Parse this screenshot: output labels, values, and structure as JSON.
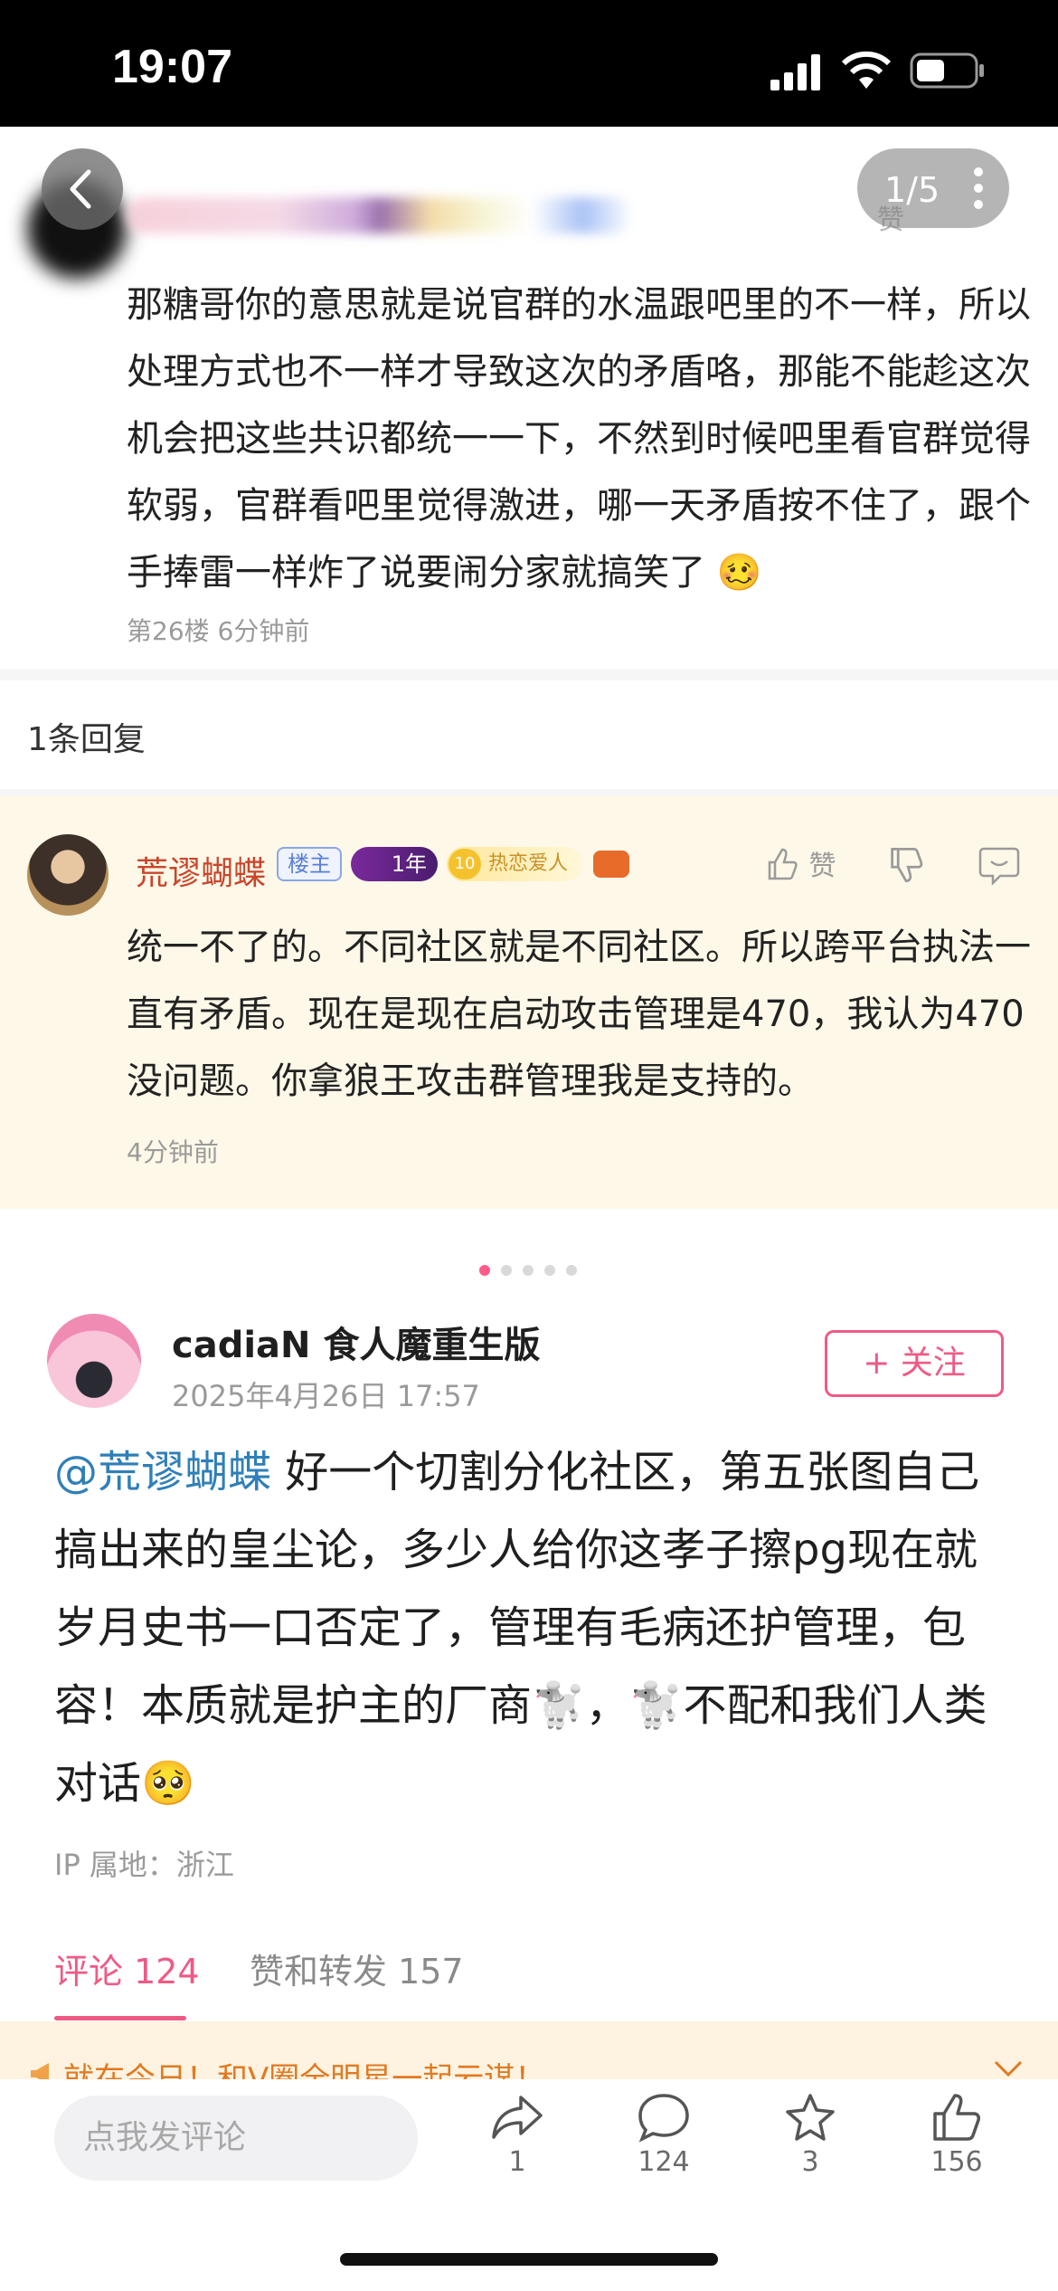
{
  "status_bar": {
    "time": "19:07"
  },
  "screenshot": {
    "pager": "1/5",
    "ghost_like": "赞",
    "comment_text": "那糖哥你的意思就是说官群的水温跟吧里的不一样，所以处理方式也不一样才导致这次的矛盾咯，那能不能趁这次机会把这些共识都统一一下，不然到时候吧里看官群觉得软弱，官群看吧里觉得激进，哪一天矛盾按不住了，跟个手捧雷一样炸了说要闹分家就搞笑了 🥴",
    "comment_meta": "第26楼  6分钟前",
    "reply_header": "1条回复",
    "reply": {
      "name": "荒谬蝴蝶",
      "badge_owner": "楼主",
      "badge_years": "1年",
      "badge_level_num": "10",
      "badge_level_text": "热恋爱人",
      "like_label": "赞",
      "text": "统一不了的。不同社区就是不同社区。所以跨平台执法一直有矛盾。现在是现在启动攻击管理是470，我认为470没问题。你拿狼王攻击群管理我是支持的。",
      "meta": "4分钟前"
    }
  },
  "post": {
    "author": "cadiaN 食人魔重生版",
    "date": "2025年4月26日 17:57",
    "follow_label": "+ 关注",
    "mention": "@荒谬蝴蝶",
    "body": " 好一个切割分化社区，第五张图自己搞出来的皇尘论，多少人给你这孝子擦pg现在就岁月史书一口否定了，管理有毛病还护管理，包容！本质就是护主的厂商🐩，🐩不配和我们人类对话🥺",
    "ip_location": "IP 属地：浙江",
    "image_index": 1,
    "image_total": 5
  },
  "tabs": {
    "comments": "评论 124",
    "likes_reposts": "赞和转发 157"
  },
  "promo": {
    "text": "就在今日！和V圈全明星一起云谋！"
  },
  "bottom_bar": {
    "comment_placeholder": "点我发评论",
    "repost_count": "1",
    "comment_count": "124",
    "favorite_count": "3",
    "like_count": "156"
  },
  "colors": {
    "accent": "#ef5a84",
    "mention": "#2f7fb8",
    "reply_bg": "#fdf8e8",
    "promo_text": "#e07a22"
  }
}
